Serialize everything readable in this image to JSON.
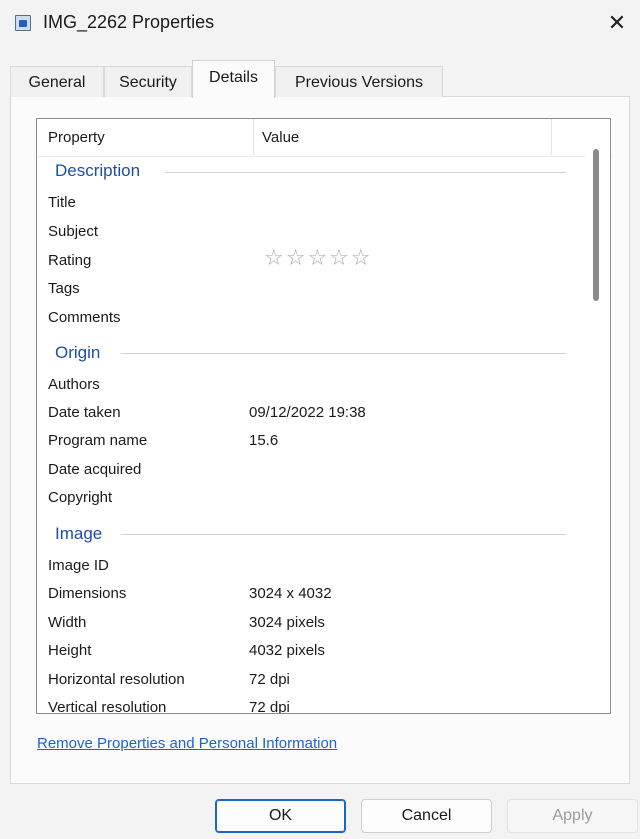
{
  "window": {
    "title": "IMG_2262 Properties",
    "icon": "image-file-icon",
    "close_glyph": "✕"
  },
  "tabs": [
    {
      "label": "General",
      "active": false
    },
    {
      "label": "Security",
      "active": false
    },
    {
      "label": "Details",
      "active": true
    },
    {
      "label": "Previous Versions",
      "active": false
    }
  ],
  "list": {
    "header": {
      "property": "Property",
      "value": "Value"
    },
    "groups": {
      "description": "Description",
      "origin": "Origin",
      "image": "Image"
    },
    "rows": {
      "title": {
        "name": "Title",
        "value": ""
      },
      "subject": {
        "name": "Subject",
        "value": ""
      },
      "rating": {
        "name": "Rating",
        "stars": "☆☆☆☆☆",
        "stars_filled": 0,
        "stars_total": 5
      },
      "tags": {
        "name": "Tags",
        "value": ""
      },
      "comments": {
        "name": "Comments",
        "value": ""
      },
      "authors": {
        "name": "Authors",
        "value": ""
      },
      "date_taken": {
        "name": "Date taken",
        "value": "09/12/2022 19:38"
      },
      "program_name": {
        "name": "Program name",
        "value": "15.6"
      },
      "date_acquired": {
        "name": "Date acquired",
        "value": ""
      },
      "copyright": {
        "name": "Copyright",
        "value": ""
      },
      "image_id": {
        "name": "Image ID",
        "value": ""
      },
      "dimensions": {
        "name": "Dimensions",
        "value": "3024 x 4032"
      },
      "width": {
        "name": "Width",
        "value": "3024 pixels"
      },
      "height": {
        "name": "Height",
        "value": "4032 pixels"
      },
      "hres": {
        "name": "Horizontal resolution",
        "value": "72 dpi"
      },
      "vres": {
        "name": "Vertical resolution",
        "value": "72 dpi"
      }
    }
  },
  "link": "Remove Properties and Personal Information",
  "buttons": {
    "ok": "OK",
    "cancel": "Cancel",
    "apply": "Apply"
  }
}
